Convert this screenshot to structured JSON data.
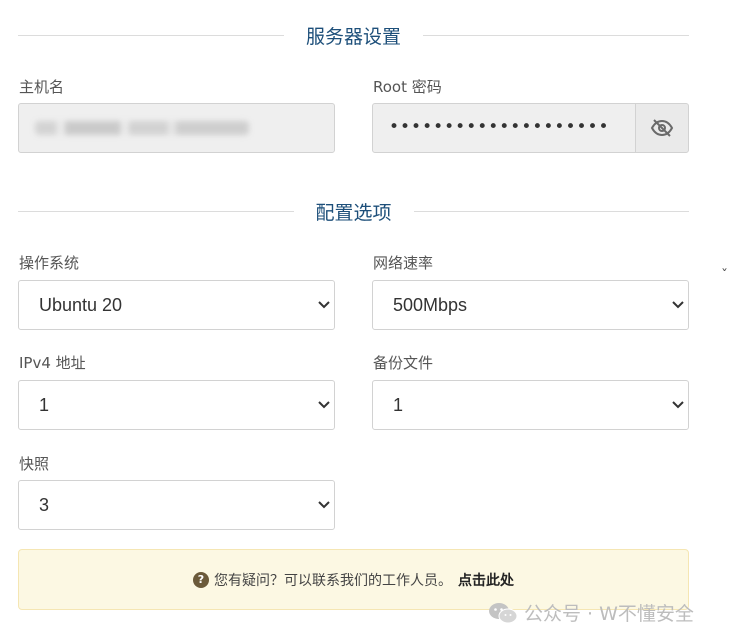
{
  "server_settings": {
    "title": "服务器设置",
    "hostname_label": "主机名",
    "root_password_label": "Root 密码",
    "root_password_value": "••••••••••••••••••••"
  },
  "config_options": {
    "title": "配置选项",
    "os_label": "操作系统",
    "os_value": "Ubuntu 20",
    "speed_label": "网络速率",
    "speed_value": "500Mbps",
    "ipv4_label": "IPv4 地址",
    "ipv4_value": "1",
    "backup_label": "备份文件",
    "backup_value": "1",
    "snapshot_label": "快照",
    "snapshot_value": "3"
  },
  "notice": {
    "icon": "question-circle-icon",
    "text": "您有疑问？可以联系我们的工作人员。",
    "link": "点击此处"
  },
  "watermark": {
    "text": "公众号 · W不懂安全",
    "icon": "wechat-icon"
  },
  "colors": {
    "section_title": "#1d4f7a",
    "notice_bg": "#fcf8e3"
  }
}
